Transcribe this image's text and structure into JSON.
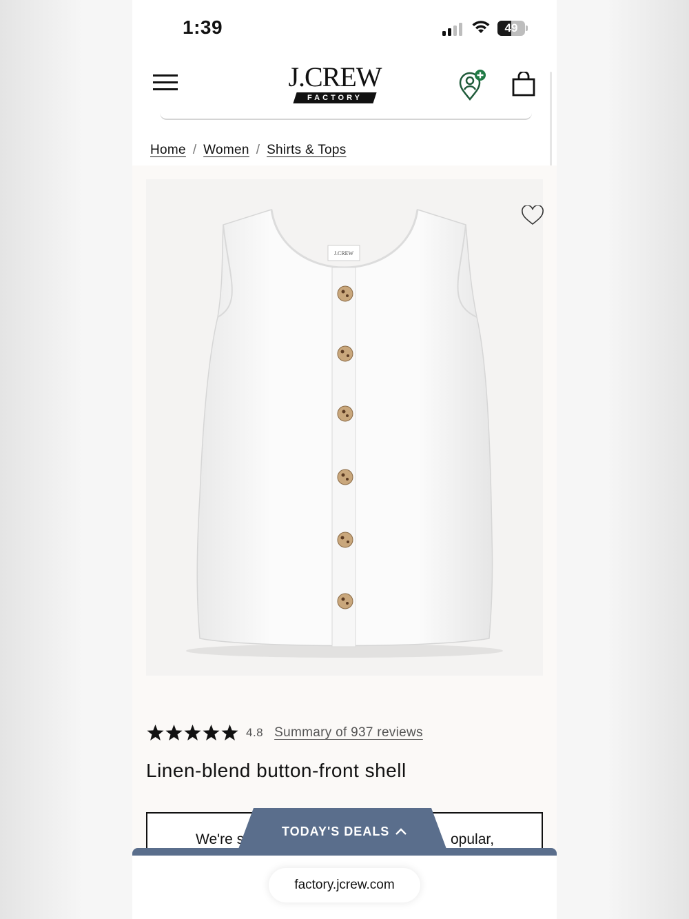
{
  "status_bar": {
    "time": "1:39",
    "battery_level": "49",
    "battery_fraction": 0.49
  },
  "header": {
    "logo_text": "J.CREW",
    "logo_badge": "FACTORY",
    "icons": [
      "hamburger-menu-icon",
      "rewards-icon",
      "shopping-bag-icon"
    ]
  },
  "breadcrumb": {
    "items": [
      "Home",
      "Women",
      "Shirts & Tops"
    ],
    "separator": "/"
  },
  "product": {
    "image_label": "J.CREW",
    "rating_value": "4.8",
    "rating_stars": 5,
    "reviews_link": "Summary of 937 reviews",
    "title": "Linen-blend button-front shell",
    "promo_left": "We're s",
    "promo_right": "opular,"
  },
  "deals": {
    "label": "TODAY'S DEALS",
    "color": "#5a6e8c"
  },
  "browser": {
    "url": "factory.jcrew.com"
  }
}
